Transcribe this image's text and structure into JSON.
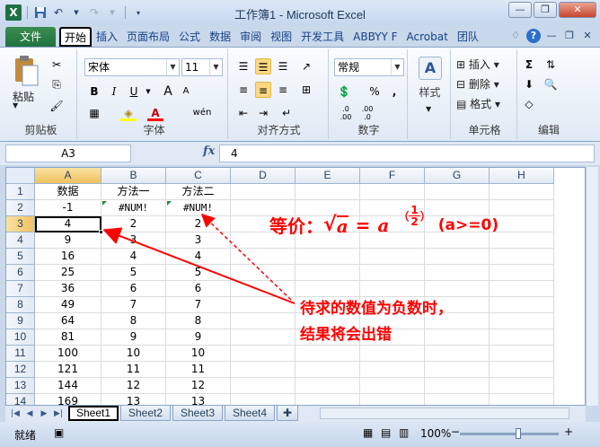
{
  "window": {
    "title": "工作簿1 - Microsoft Excel"
  },
  "qat": {
    "app_icon": "X"
  },
  "ribbon_tabs": {
    "file": "文件",
    "tabs": [
      "开始",
      "插入",
      "页面布局",
      "公式",
      "数据",
      "审阅",
      "视图",
      "开发工具",
      "ABBYY F",
      "Acrobat",
      "团队"
    ],
    "active_index": 0
  },
  "clipboard": {
    "paste": "粘贴",
    "label": "剪贴板"
  },
  "font": {
    "name": "宋体",
    "size": "11",
    "bold": "B",
    "italic": "I",
    "underline": "U",
    "grow": "A",
    "shrink": "A",
    "wen": "wén",
    "label": "字体"
  },
  "alignment": {
    "label": "对齐方式"
  },
  "number": {
    "format": "常规",
    "percent": "%",
    "comma": ",",
    "inc": ".0 .00",
    "dec": ".00 .0",
    "label": "数字"
  },
  "styles": {
    "label": "样式"
  },
  "cells_group": {
    "insert": "插入",
    "delete": "删除",
    "format": "格式",
    "label": "单元格"
  },
  "editing": {
    "sum": "Σ",
    "label": "编辑"
  },
  "formula_bar": {
    "name_box": "A3",
    "fx": "fx",
    "content": "4"
  },
  "columns": [
    "A",
    "B",
    "C",
    "D",
    "E",
    "F",
    "G",
    "H"
  ],
  "rows": [
    {
      "n": "1",
      "a": "数据",
      "b": "方法一",
      "c": "方法二"
    },
    {
      "n": "2",
      "a": "-1",
      "b": "#NUM!",
      "c": "#NUM!"
    },
    {
      "n": "3",
      "a": "4",
      "b": "2",
      "c": "2"
    },
    {
      "n": "4",
      "a": "9",
      "b": "3",
      "c": "3"
    },
    {
      "n": "5",
      "a": "16",
      "b": "4",
      "c": "4"
    },
    {
      "n": "6",
      "a": "25",
      "b": "5",
      "c": "5"
    },
    {
      "n": "7",
      "a": "36",
      "b": "6",
      "c": "6"
    },
    {
      "n": "8",
      "a": "49",
      "b": "7",
      "c": "7"
    },
    {
      "n": "9",
      "a": "64",
      "b": "8",
      "c": "8"
    },
    {
      "n": "10",
      "a": "81",
      "b": "9",
      "c": "9"
    },
    {
      "n": "11",
      "a": "100",
      "b": "10",
      "c": "10"
    },
    {
      "n": "12",
      "a": "121",
      "b": "11",
      "c": "11"
    },
    {
      "n": "13",
      "a": "144",
      "b": "12",
      "c": "12"
    },
    {
      "n": "14",
      "a": "169",
      "b": "13",
      "c": "13"
    }
  ],
  "annotations": {
    "equiv_label": "等价：",
    "sqrt": "√",
    "a": "a",
    "equals": "=",
    "base": "a",
    "lparen": "（",
    "frac_num": "1",
    "frac_den": "2",
    "rparen": "）",
    "condition": "(a>=0)",
    "note_line1": "待求的数值为负数时，",
    "note_line2": "结果将会出错"
  },
  "sheet_tabs": [
    "Sheet1",
    "Sheet2",
    "Sheet3",
    "Sheet4"
  ],
  "status": {
    "ready": "就绪",
    "zoom": "100%"
  },
  "colors": {
    "annotation": "#ff0000",
    "accent": "#207340"
  }
}
